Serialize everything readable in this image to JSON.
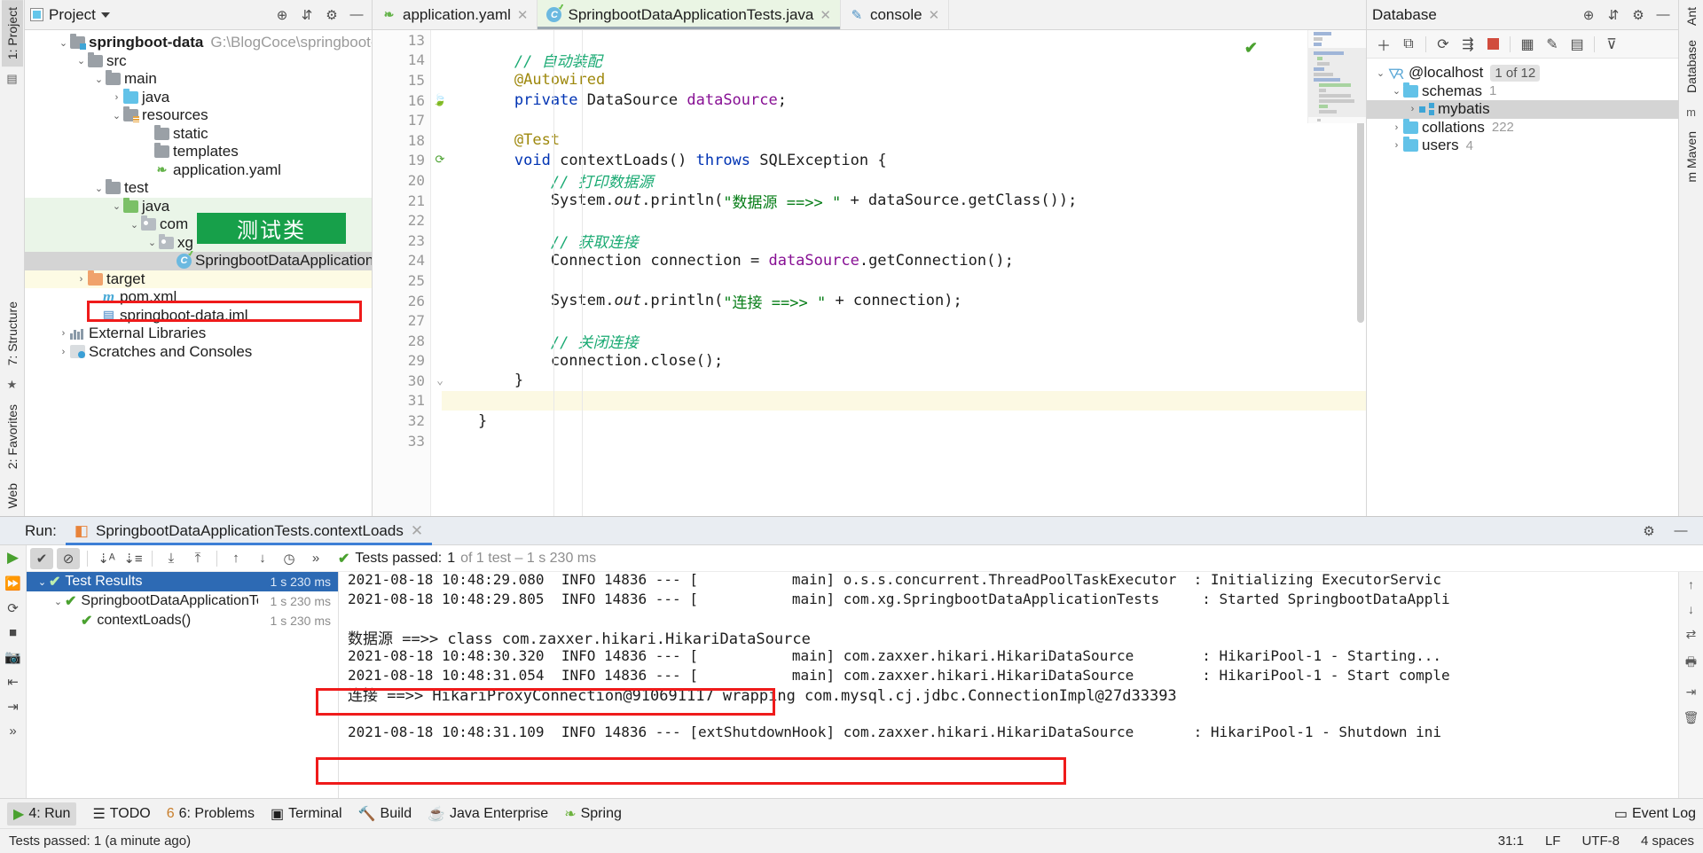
{
  "project_panel": {
    "title": "Project",
    "icons": [
      "locate-icon",
      "collapse-all-icon",
      "settings-icon",
      "hide-icon"
    ],
    "tree": [
      {
        "label": "springboot-data",
        "path": "G:\\BlogCoce\\springboot-data",
        "icon": "module-folder-icon",
        "depth": 0,
        "arrow": "expanded",
        "bold": true
      },
      {
        "label": "src",
        "icon": "folder-icon",
        "depth": 1,
        "arrow": "expanded"
      },
      {
        "label": "main",
        "icon": "folder-icon",
        "depth": 2,
        "arrow": "expanded"
      },
      {
        "label": "java",
        "icon": "sources-folder-icon",
        "depth": 3,
        "arrow": "collapsed"
      },
      {
        "label": "resources",
        "icon": "resources-folder-icon",
        "depth": 3,
        "arrow": "expanded"
      },
      {
        "label": "static",
        "icon": "folder-icon",
        "depth": 4,
        "arrow": "none"
      },
      {
        "label": "templates",
        "icon": "folder-icon",
        "depth": 4,
        "arrow": "none"
      },
      {
        "label": "application.yaml",
        "icon": "yaml-file-icon",
        "depth": 4,
        "arrow": "none"
      },
      {
        "label": "test",
        "icon": "folder-icon",
        "depth": 2,
        "arrow": "expanded"
      },
      {
        "label": "java",
        "icon": "test-sources-folder-icon",
        "depth": 3,
        "arrow": "expanded",
        "bg": "green"
      },
      {
        "label": "com",
        "icon": "package-icon",
        "depth": 4,
        "arrow": "expanded",
        "bg": "green"
      },
      {
        "label": "xg",
        "icon": "package-icon",
        "depth": 5,
        "arrow": "expanded",
        "bg": "green"
      },
      {
        "label": "SpringbootDataApplicationTests",
        "icon": "java-test-class-icon",
        "depth": 6,
        "arrow": "none",
        "bg": "selected"
      },
      {
        "label": "target",
        "icon": "excluded-folder-icon",
        "depth": 1,
        "arrow": "collapsed",
        "bg": "yellow"
      },
      {
        "label": "pom.xml",
        "icon": "maven-file-icon",
        "depth": 1,
        "arrow": "none"
      },
      {
        "label": "springboot-data.iml",
        "icon": "iml-file-icon",
        "depth": 1,
        "arrow": "none"
      },
      {
        "label": "External Libraries",
        "icon": "libraries-icon",
        "depth": 0,
        "arrow": "collapsed"
      },
      {
        "label": "Scratches and Consoles",
        "icon": "scratches-icon",
        "depth": 0,
        "arrow": "collapsed"
      }
    ]
  },
  "annotations": {
    "green_note": "测试类"
  },
  "editor": {
    "tabs": [
      {
        "label": "application.yaml",
        "icon": "yaml-file-icon",
        "active": false,
        "closable": true
      },
      {
        "label": "SpringbootDataApplicationTests.java",
        "icon": "java-test-class-icon",
        "active": true,
        "closable": true
      },
      {
        "label": "console",
        "icon": "console-icon",
        "active": false,
        "closable": true
      }
    ],
    "first_line_number": 13,
    "lines": [
      {
        "n": 13,
        "segments": [],
        "gutter": ""
      },
      {
        "n": 14,
        "segments": [
          {
            "t": "        ",
            "c": ""
          },
          {
            "t": "// 自动装配",
            "c": "cm"
          }
        ],
        "gutter": ""
      },
      {
        "n": 15,
        "segments": [
          {
            "t": "        ",
            "c": ""
          },
          {
            "t": "@Autowired",
            "c": "an"
          }
        ],
        "gutter": ""
      },
      {
        "n": 16,
        "segments": [
          {
            "t": "        ",
            "c": ""
          },
          {
            "t": "private ",
            "c": "kw"
          },
          {
            "t": "DataSource ",
            "c": ""
          },
          {
            "t": "dataSource",
            "c": "fld"
          },
          {
            "t": ";",
            "c": ""
          }
        ],
        "gutter": "bean-icon"
      },
      {
        "n": 17,
        "segments": [],
        "gutter": ""
      },
      {
        "n": 18,
        "segments": [
          {
            "t": "        ",
            "c": ""
          },
          {
            "t": "@Test",
            "c": "an"
          }
        ],
        "gutter": ""
      },
      {
        "n": 19,
        "segments": [
          {
            "t": "        ",
            "c": ""
          },
          {
            "t": "void ",
            "c": "kw"
          },
          {
            "t": "contextLoads() ",
            "c": ""
          },
          {
            "t": "throws ",
            "c": "kw"
          },
          {
            "t": "SQLException {",
            "c": ""
          }
        ],
        "gutter": "run-test-icon"
      },
      {
        "n": 20,
        "segments": [
          {
            "t": "            ",
            "c": ""
          },
          {
            "t": "// 打印数据源",
            "c": "cm"
          }
        ],
        "gutter": ""
      },
      {
        "n": 21,
        "segments": [
          {
            "t": "            System.",
            "c": ""
          },
          {
            "t": "out",
            "c": "it"
          },
          {
            "t": ".println(",
            "c": ""
          },
          {
            "t": "\"数据源 ==>> \"",
            "c": "st"
          },
          {
            "t": " + dataSource.getClass());",
            "c": ""
          }
        ],
        "gutter": ""
      },
      {
        "n": 22,
        "segments": [],
        "gutter": ""
      },
      {
        "n": 23,
        "segments": [
          {
            "t": "            ",
            "c": ""
          },
          {
            "t": "// 获取连接",
            "c": "cm"
          }
        ],
        "gutter": ""
      },
      {
        "n": 24,
        "segments": [
          {
            "t": "            Connection connection = ",
            "c": ""
          },
          {
            "t": "dataSource",
            "c": "fld"
          },
          {
            "t": ".getConnection();",
            "c": ""
          }
        ],
        "gutter": ""
      },
      {
        "n": 25,
        "segments": [],
        "gutter": ""
      },
      {
        "n": 26,
        "segments": [
          {
            "t": "            System.",
            "c": ""
          },
          {
            "t": "out",
            "c": "it"
          },
          {
            "t": ".println(",
            "c": ""
          },
          {
            "t": "\"连接 ==>> \"",
            "c": "st"
          },
          {
            "t": " + connection);",
            "c": ""
          }
        ],
        "gutter": ""
      },
      {
        "n": 27,
        "segments": [],
        "gutter": ""
      },
      {
        "n": 28,
        "segments": [
          {
            "t": "            ",
            "c": ""
          },
          {
            "t": "// 关闭连接",
            "c": "cm"
          }
        ],
        "gutter": ""
      },
      {
        "n": 29,
        "segments": [
          {
            "t": "            connection.close();",
            "c": ""
          }
        ],
        "gutter": ""
      },
      {
        "n": 30,
        "segments": [
          {
            "t": "        }",
            "c": ""
          }
        ],
        "gutter": "fold-icon"
      },
      {
        "n": 31,
        "segments": [],
        "gutter": "",
        "highlight": true
      },
      {
        "n": 32,
        "segments": [
          {
            "t": "    }",
            "c": ""
          }
        ],
        "gutter": ""
      },
      {
        "n": 33,
        "segments": [],
        "gutter": ""
      }
    ]
  },
  "database_panel": {
    "title": "Database",
    "toolbar_icons": [
      "add-icon",
      "copy-icon",
      "refresh-icon",
      "run-query-icon",
      "stop-icon",
      "table-icon",
      "edit-icon",
      "console-icon",
      "filter-icon"
    ],
    "tree": [
      {
        "label": "@localhost",
        "icon": "mysql-icon",
        "badge": "1 of 12",
        "depth": 0,
        "arrow": "expanded"
      },
      {
        "label": "schemas",
        "icon": "folder-icon",
        "count": "1",
        "depth": 1,
        "arrow": "expanded"
      },
      {
        "label": "mybatis",
        "icon": "schema-icon",
        "depth": 2,
        "arrow": "collapsed",
        "selected": true
      },
      {
        "label": "collations",
        "icon": "folder-icon",
        "count": "222",
        "depth": 1,
        "arrow": "collapsed"
      },
      {
        "label": "users",
        "icon": "folder-icon",
        "count": "4",
        "depth": 1,
        "arrow": "collapsed"
      }
    ]
  },
  "right_rail": {
    "tabs": [
      "Ant",
      "Database",
      "m Maven"
    ]
  },
  "left_rail": {
    "tabs": [
      "1: Project",
      "7: Structure",
      "2: Favorites",
      "Web"
    ]
  },
  "run_window": {
    "label": "Run:",
    "tab_title": "SpringbootDataApplicationTests.contextLoads",
    "toolbar_icons": [
      "rerun-icon",
      "rerun-failed-icon",
      "toggle-passed-icon",
      "toggle-ignored-icon",
      "sort-alpha-icon",
      "sort-duration-icon",
      "expand-all-icon",
      "collapse-all-icon",
      "prev-failed-icon",
      "next-failed-icon",
      "history-icon"
    ],
    "status": {
      "prefix": "Tests passed:",
      "count": "1",
      "suffix": "of 1 test – 1 s 230 ms"
    },
    "tests": [
      {
        "label": "Test Results",
        "duration": "1 s 230 ms",
        "depth": 0,
        "arrow": "expanded",
        "selected": true
      },
      {
        "label": "SpringbootDataApplicationTe",
        "duration": "1 s 230 ms",
        "depth": 1,
        "arrow": "expanded"
      },
      {
        "label": "contextLoads()",
        "duration": "1 s 230 ms",
        "depth": 2,
        "arrow": "none"
      }
    ],
    "console_lines": [
      {
        "text": "2021-08-18 10:48:29.080  INFO 14836 --- [           main] o.s.s.concurrent.ThreadPoolTaskExecutor  : Initializing ExecutorServic",
        "clipped_top": true
      },
      {
        "text": "2021-08-18 10:48:29.805  INFO 14836 --- [           main] com.xg.SpringbootDataApplicationTests     : Started SpringbootDataAppli"
      },
      {
        "text": ""
      },
      {
        "text": "数据源 ==>> class com.zaxxer.hikari.HikariDataSource",
        "boxed": true
      },
      {
        "text": "2021-08-18 10:48:30.320  INFO 14836 --- [           main] com.zaxxer.hikari.HikariDataSource        : HikariPool-1 - Starting..."
      },
      {
        "text": "2021-08-18 10:48:31.054  INFO 14836 --- [           main] com.zaxxer.hikari.HikariDataSource        : HikariPool-1 - Start comple"
      },
      {
        "text": "连接 ==>> HikariProxyConnection@910691117 wrapping com.mysql.cj.jdbc.ConnectionImpl@27d33393",
        "boxed": true
      },
      {
        "text": ""
      },
      {
        "text": "2021-08-18 10:48:31.109  INFO 14836 --- [extShutdownHook] com.zaxxer.hikari.HikariDataSource       : HikariPool-1 - Shutdown ini"
      }
    ],
    "console_rail_icons": [
      "scroll-up-icon",
      "scroll-down-icon",
      "soft-wrap-icon",
      "print-icon",
      "export-icon",
      "trash-icon"
    ]
  },
  "status_bar": {
    "items": [
      {
        "label": "4: Run",
        "icon": "run-icon",
        "active": true
      },
      {
        "label": "TODO",
        "icon": "todo-icon"
      },
      {
        "label": "6: Problems",
        "icon": "problems-icon"
      },
      {
        "label": "Terminal",
        "icon": "terminal-icon"
      },
      {
        "label": "Build",
        "icon": "build-icon"
      },
      {
        "label": "Java Enterprise",
        "icon": "java-enterprise-icon"
      },
      {
        "label": "Spring",
        "icon": "spring-icon"
      }
    ],
    "event_log": "Event Log"
  },
  "bottom_bar": {
    "message": "Tests passed: 1 (a minute ago)",
    "caret": "31:1",
    "line_sep": "LF",
    "encoding": "UTF-8",
    "indent": "4 spaces"
  },
  "colors": {
    "accent_blue": "#2d6ab4",
    "pass_green": "#4aa12f",
    "highlight_red": "#ef1b1b",
    "note_green": "#17a04a"
  }
}
